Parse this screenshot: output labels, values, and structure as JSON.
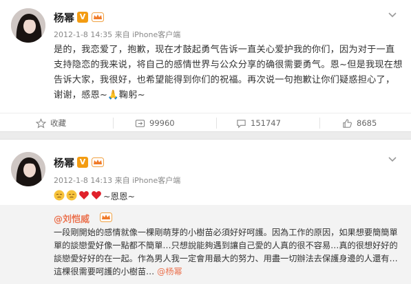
{
  "post1": {
    "author": "杨幂",
    "v_badge": "V",
    "meta": "2012-1-8 14:35 来自 iPhone客户端",
    "text": "是的，我恋爱了，抱歉，现在才鼓起勇气告诉一直关心爱护我的你们，因为对于一直支持隐恋的我来说，将自己的感情世界与公众分享的确很需要勇气。恩~但是我现在想告诉大家，我很好，也希望能得到你们的祝福。再次说一句抱歉让你们疑惑担心了，谢谢，感恩~🙏鞠躬~",
    "actions": {
      "favorite": "收藏",
      "repost": "99960",
      "comment": "151747",
      "like": "8685"
    }
  },
  "post2": {
    "author": "杨幂",
    "v_badge": "V",
    "meta": "2012-1-8 14:13 来自 iPhone客户端",
    "text": "~恩恩~",
    "quote": {
      "author": "@刘恺威",
      "text": "一段剛開始的感情就像一棵剛萌芽的小樹苗必須好好呵護。因為工作的原因，如果想要簡簡單單的談戀愛好像一點都不簡單…只想說能夠遇到讓自己愛的人真的很不容易…真的很想好好的談戀愛好好的在一起。作為男人我一定會用最大的努力、用盡一切辦法去保護身邊的人還有…這棵很需要呵護的小樹苗… ",
      "mention": "@杨幂"
    }
  },
  "colors": {
    "accent": "#eb7350",
    "v_badge": "#f39c12",
    "heart": "#e0212b"
  }
}
